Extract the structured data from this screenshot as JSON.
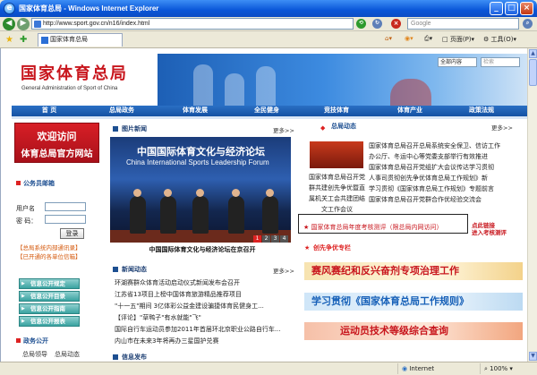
{
  "window": {
    "title": "国家体育总局 - Windows Internet Explorer",
    "url": "http://www.sport.gov.cn/n16/index.html",
    "search_placeholder": "Google"
  },
  "tabs": [
    {
      "label": "国家体育总局"
    }
  ],
  "toolbar": {
    "page_label": "页面(P)",
    "tools_label": "工具(O)"
  },
  "status": {
    "zone": "Internet",
    "zoom": "100%"
  },
  "site": {
    "logo_cn": "国家体育总局",
    "logo_en": "General Administration of Sport of China",
    "select_value": "全部内容",
    "search_placeholder": "检索"
  },
  "mainnav": [
    "首 页",
    "总局政务",
    "体育发展",
    "全民健身",
    "竞技体育",
    "体育产业",
    "政策法规"
  ],
  "left": {
    "promo_line1": "欢迎访问",
    "promo_line2": "体育总局官方网站",
    "mail_title": "公务员邮箱",
    "user_label": "用户名",
    "pass_label": "密  码：",
    "login_label": "登录",
    "link1": "【总局系统内部通讯录】",
    "link2": "【已开通的各单位信箱】",
    "buttons": [
      "信息公开规定",
      "信息公开目录",
      "信息公开指南",
      "信息公开报表"
    ],
    "gov_title": "政务公开",
    "gov_links": [
      "总局领导",
      "总局动态"
    ]
  },
  "center": {
    "photo_title": "图片新闻",
    "more": "更多>>",
    "forum_cn": "中国国际体育文化与经济论坛",
    "forum_en1": "China International Sports Leadership Forum",
    "forum_en2": "",
    "pager": [
      "1",
      "2",
      "3",
      "4"
    ],
    "photo_caption": "中国国际体育文化与经济论坛在京召开",
    "news_title": "新闻动态",
    "news": [
      "环湖赛群众体育活动启动仪式新闻发布会召开",
      "江苏省13项目上榜中国体育旅游精品推荐项目",
      "\"十一五\"期间 3亿体彩公益金建设骗捷体育民健身工...",
      "【评论】\"草鸭子\"有水就能\"飞\"",
      "国际自行车运动员参加2011年首届环北京职业公路自行车...",
      "内山市在未来3年将再办三星国护兑赛"
    ],
    "info_title": "信息发布"
  },
  "right": {
    "dyn_title": "总局动态",
    "dyn_news": [
      "国家体育总局召开总局系统安全保卫、信访工作",
      "办公厅、冬运中心等党委支部举行有效推进",
      "国家体育总局召开党组扩大会议传达学习贯彻",
      "人事司贯彻创先争优体育总局工作规划》新",
      "学习贯彻《国家体育总局工作规划》专题前言",
      "国家体育总局召开党群合作优经验交流会"
    ],
    "left_caption": [
      "国家体育总局召开党",
      "群共建创先争优暨直",
      "属机关工会共建团结",
      "文工作会议"
    ],
    "notice_text": "★ 国家体育总局年度考核测评（限总局内网访问）",
    "notice_side1": "点此链接",
    "notice_side2": "进入考核测评",
    "creative_title": "创先争优专栏",
    "banner1": "赛风赛纪和反兴奋剂专项治理工作",
    "banner2": "学习贯彻《国家体育总局工作规则》",
    "banner3": "运动员技术等级综合查询"
  }
}
